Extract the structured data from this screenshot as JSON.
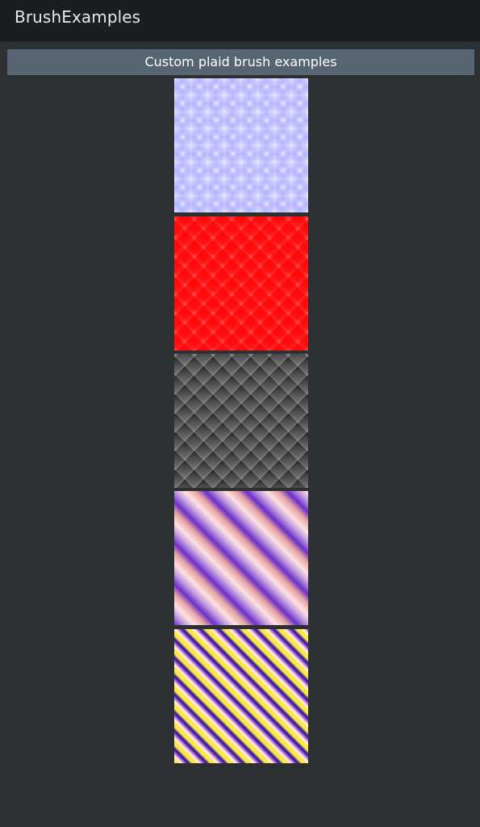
{
  "app": {
    "title": "BrushExamples"
  },
  "header": {
    "text": "Custom plaid brush examples"
  },
  "colors": {
    "app_bar_bg": "#1b1e21",
    "page_bg": "#2d3033",
    "header_bg": "#566571",
    "header_text": "#ffffff",
    "title_text": "#e6e8ea"
  },
  "brushes": [
    {
      "pattern": "blue-soft-plaid"
    },
    {
      "pattern": "red-quilted-diamond"
    },
    {
      "pattern": "dark-quilted-diamond"
    },
    {
      "pattern": "purple-diagonal-plaid"
    },
    {
      "pattern": "yellow-purple-lattice"
    }
  ]
}
